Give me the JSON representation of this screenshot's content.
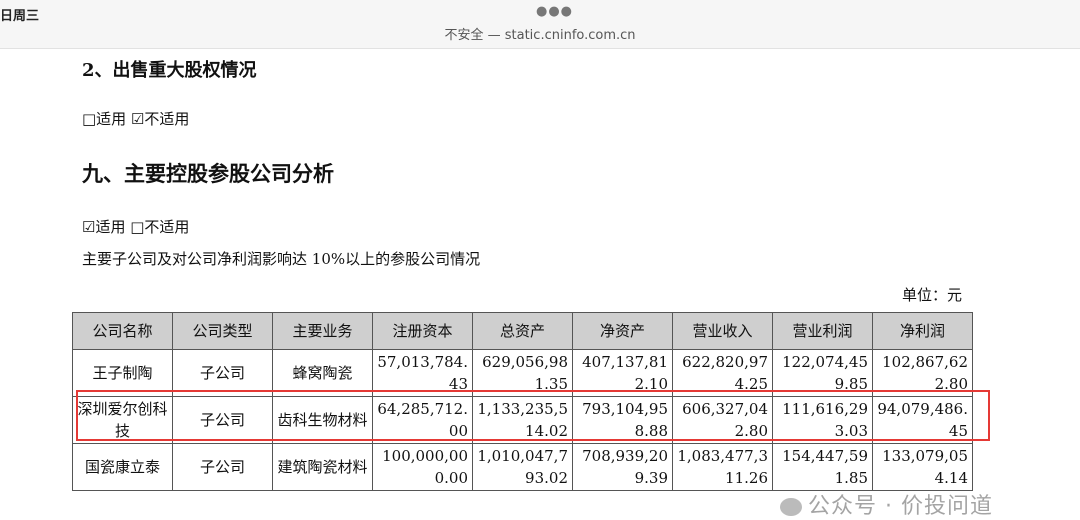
{
  "status_bar": {
    "time": "日周三"
  },
  "browser": {
    "security_label": "不安全",
    "url": "static.cninfo.com.cn"
  },
  "doc": {
    "section_heading": "2、出售重大股权情况",
    "section_applicability": "□适用 ☑不适用",
    "chapter_heading": "九、主要控股参股公司分析",
    "chapter_applicability": "☑适用 □不适用",
    "intro": "主要子公司及对公司净利润影响达 10%以上的参股公司情况",
    "unit": "单位：元"
  },
  "table": {
    "headers": [
      "公司名称",
      "公司类型",
      "主要业务",
      "注册资本",
      "总资产",
      "净资产",
      "营业收入",
      "营业利润",
      "净利润"
    ],
    "rows": [
      [
        "王子制陶",
        "子公司",
        "蜂窝陶瓷",
        "57,013,784.43",
        "629,056,981.35",
        "407,137,812.10",
        "622,820,974.25",
        "122,074,459.85",
        "102,867,622.80"
      ],
      [
        "深圳爱尔创科技",
        "子公司",
        "齿科生物材料",
        "64,285,712.00",
        "1,133,235,514.02",
        "793,104,958.88",
        "606,327,042.80",
        "111,616,293.03",
        "94,079,486.45"
      ],
      [
        "国瓷康立泰",
        "子公司",
        "建筑陶瓷材料",
        "100,000,000.00",
        "1,010,047,793.02",
        "708,939,209.39",
        "1,083,477,311.26",
        "154,447,591.85",
        "133,079,054.14"
      ]
    ]
  },
  "watermark": "公众号 · 价投问道",
  "colors": {
    "highlight_border": "#e53935",
    "header_bg": "#cfcfcf"
  }
}
